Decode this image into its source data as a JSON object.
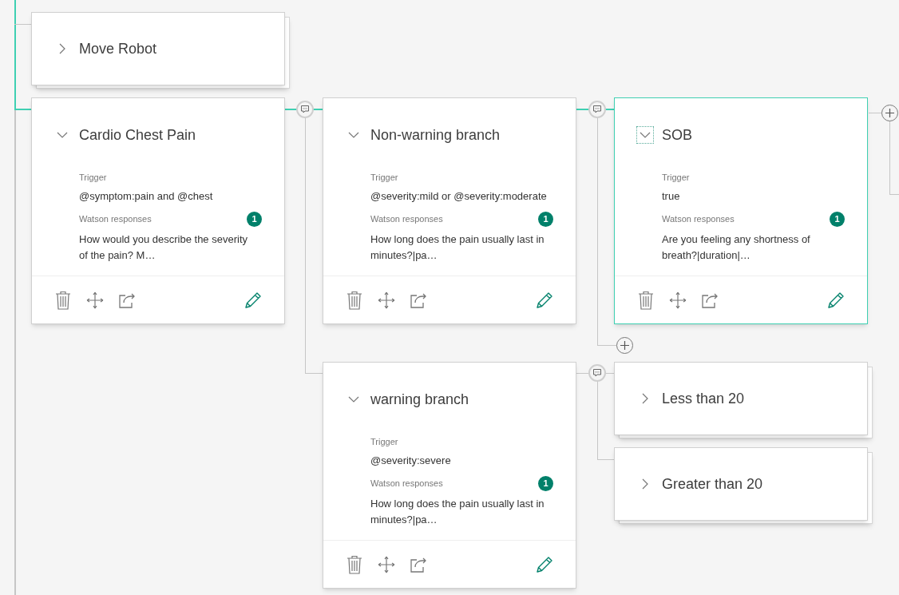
{
  "nodes": [
    {
      "title": "Move Robot",
      "expanded": false,
      "stacked": true,
      "selected": false
    },
    {
      "title": "Cardio Chest Pain",
      "expanded": true,
      "stacked": false,
      "selected": false,
      "trigger_label": "Trigger",
      "trigger": "@symptom:pain and @chest",
      "responses_label": "Watson responses",
      "response_count": "1",
      "response": "How would you describe the severity of the pain? M…"
    },
    {
      "title": "Non-warning branch",
      "expanded": true,
      "stacked": false,
      "selected": false,
      "trigger_label": "Trigger",
      "trigger": "@severity:mild or @severity:moderate",
      "responses_label": "Watson responses",
      "response_count": "1",
      "response": "How long does the pain usually last in minutes?|pa…"
    },
    {
      "title": "SOB",
      "expanded": true,
      "stacked": false,
      "selected": true,
      "trigger_label": "Trigger",
      "trigger": "true",
      "responses_label": "Watson responses",
      "response_count": "1",
      "response": "Are you feeling any shortness of breath?|duration|…"
    },
    {
      "title": "warning branch",
      "expanded": true,
      "stacked": false,
      "selected": false,
      "trigger_label": "Trigger",
      "trigger": "@severity:severe",
      "responses_label": "Watson responses",
      "response_count": "1",
      "response": "How long does the pain usually last in minutes?|pa…"
    },
    {
      "title": "Less than 20",
      "expanded": false,
      "stacked": true,
      "selected": false
    },
    {
      "title": "Greater than 20",
      "expanded": false,
      "stacked": true,
      "selected": false
    }
  ]
}
